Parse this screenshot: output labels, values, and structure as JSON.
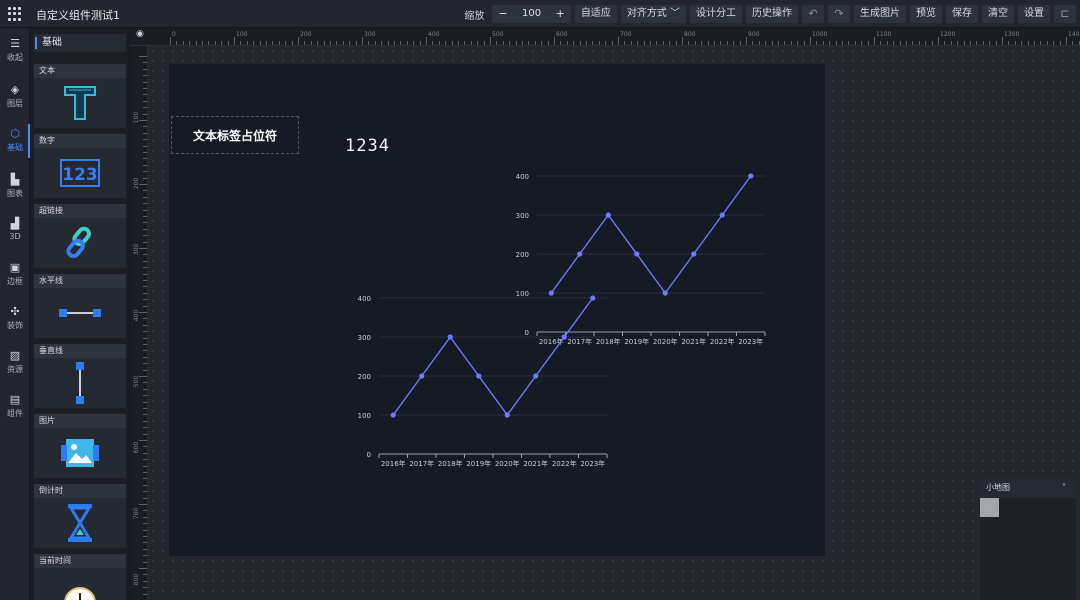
{
  "app": {
    "title": "自定义组件测试1"
  },
  "toolbar": {
    "zoom_label": "缩放",
    "zoom_minus": "−",
    "zoom_value": "100",
    "zoom_plus": "+",
    "fit": "自适应",
    "align": "对齐方式",
    "design_tab": "设计分工",
    "history": "历史操作",
    "undo_icon": "undo-icon",
    "redo_icon": "redo-icon",
    "gen_image": "生成图片",
    "preview": "预览",
    "save": "保存",
    "clear": "清空",
    "settings": "设置"
  },
  "leftnav": {
    "items": [
      {
        "label": "收起",
        "icon": "collapse-icon",
        "glyph": "☰"
      },
      {
        "label": "图层",
        "icon": "layers-icon",
        "glyph": "◈"
      },
      {
        "label": "基础",
        "icon": "basic-icon",
        "glyph": "⬡"
      },
      {
        "label": "图表",
        "icon": "chart-icon",
        "glyph": "▙"
      },
      {
        "label": "3D",
        "icon": "cube-icon",
        "glyph": "▟"
      },
      {
        "label": "边框",
        "icon": "border-icon",
        "glyph": "▣"
      },
      {
        "label": "装饰",
        "icon": "decoration-icon",
        "glyph": "✣"
      },
      {
        "label": "资源",
        "icon": "image-icon",
        "glyph": "▨"
      },
      {
        "label": "组件",
        "icon": "component-icon",
        "glyph": "▤"
      }
    ],
    "active": 2
  },
  "panel": {
    "title": "基础",
    "components": [
      {
        "label": "文本",
        "icon": "text-t-icon"
      },
      {
        "label": "数字",
        "icon": "number-123-icon"
      },
      {
        "label": "超链接",
        "icon": "link-icon"
      },
      {
        "label": "水平线",
        "icon": "horizontal-line-icon"
      },
      {
        "label": "垂直线",
        "icon": "vertical-line-icon"
      },
      {
        "label": "图片",
        "icon": "picture-icon"
      },
      {
        "label": "倒计时",
        "icon": "hourglass-icon"
      },
      {
        "label": "当前时间",
        "icon": "clock-icon"
      }
    ]
  },
  "ruler": {
    "top": [
      "0",
      "100",
      "200",
      "300",
      "400",
      "500",
      "600",
      "700",
      "800",
      "900",
      "1000",
      "1100",
      "1200",
      "1300",
      "140"
    ],
    "left": [
      "100",
      "200",
      "300",
      "400",
      "500",
      "600",
      "700",
      "800"
    ]
  },
  "canvas": {
    "text_label": "文本标签占位符",
    "digit": "1234"
  },
  "chart_data": [
    {
      "type": "line",
      "categories": [
        "2016年",
        "2017年",
        "2018年",
        "2019年",
        "2020年",
        "2021年",
        "2022年",
        "2023年"
      ],
      "values": [
        100,
        200,
        300,
        200,
        100,
        200,
        300,
        400
      ],
      "yticks": [
        "0",
        "100",
        "200",
        "300",
        "400"
      ],
      "ylim": [
        0,
        400
      ],
      "color": "#6c7bff"
    },
    {
      "type": "line",
      "categories": [
        "2016年",
        "2017年",
        "2018年",
        "2019年",
        "2020年",
        "2021年",
        "2022年",
        "2023年"
      ],
      "values": [
        100,
        200,
        300,
        200,
        100,
        200,
        300,
        400
      ],
      "yticks": [
        "0",
        "100",
        "200",
        "300",
        "400"
      ],
      "ylim": [
        0,
        400
      ],
      "color": "#6c7bff"
    }
  ],
  "minimap": {
    "title": "小地图",
    "toggle_icon": "chevron-up-icon",
    "toggle": "˄"
  }
}
